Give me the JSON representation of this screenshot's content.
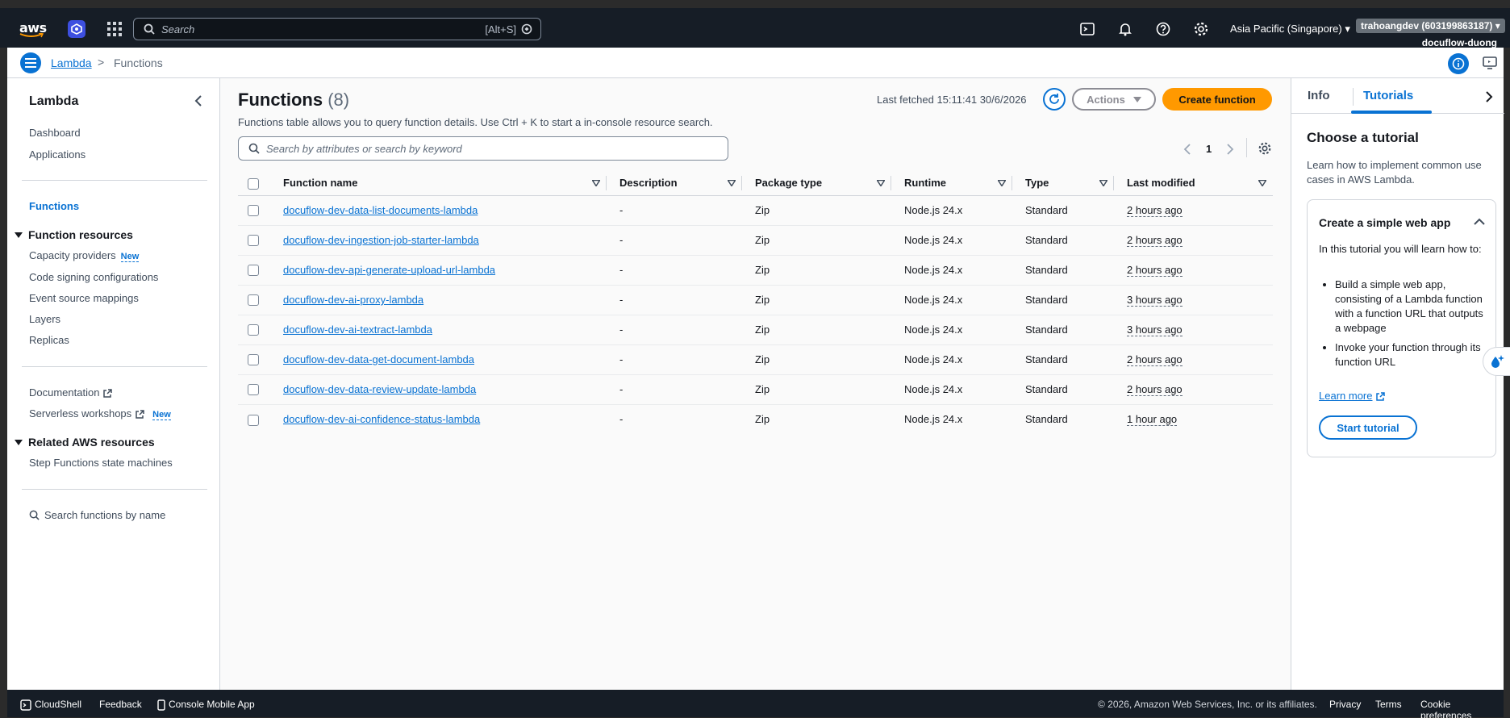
{
  "topnav": {
    "logo_text": "aws",
    "search_placeholder": "Search",
    "search_shortcut": "[Alt+S]",
    "region": "Asia Pacific (Singapore)",
    "account_badge": "trahoangdev (603199863187)",
    "account_name": "docuflow-duong"
  },
  "breadcrumb": {
    "root": "Lambda",
    "separator": ">",
    "current": "Functions"
  },
  "sidebar": {
    "title": "Lambda",
    "top_items": [
      "Dashboard",
      "Applications"
    ],
    "active_item": "Functions",
    "function_resources": {
      "label": "Function resources",
      "items": [
        "Capacity providers",
        "Code signing configurations",
        "Event source mappings",
        "Layers",
        "Replicas"
      ],
      "new_badge": "New"
    },
    "links": {
      "documentation": "Documentation",
      "serverless_workshops": "Serverless workshops",
      "new_badge": "New"
    },
    "related": {
      "label": "Related AWS resources",
      "items": [
        "Step Functions state machines"
      ]
    },
    "search_label": "Search functions by name"
  },
  "main": {
    "title": "Functions",
    "count": "(8)",
    "description": "Functions table allows you to query function details. Use Ctrl + K to start a in-console resource search.",
    "last_fetched": "Last fetched 15:11:41 30/6/2026",
    "actions_label": "Actions",
    "create_label": "Create function",
    "filter_placeholder": "Search by attributes or search by keyword",
    "page_number": "1",
    "columns": [
      "Function name",
      "Description",
      "Package type",
      "Runtime",
      "Type",
      "Last modified"
    ],
    "rows": [
      {
        "name": "docuflow-dev-data-list-documents-lambda",
        "description": "-",
        "package": "Zip",
        "runtime": "Node.js 24.x",
        "type": "Standard",
        "modified": "2 hours ago"
      },
      {
        "name": "docuflow-dev-ingestion-job-starter-lambda",
        "description": "-",
        "package": "Zip",
        "runtime": "Node.js 24.x",
        "type": "Standard",
        "modified": "2 hours ago"
      },
      {
        "name": "docuflow-dev-api-generate-upload-url-lambda",
        "description": "-",
        "package": "Zip",
        "runtime": "Node.js 24.x",
        "type": "Standard",
        "modified": "2 hours ago"
      },
      {
        "name": "docuflow-dev-ai-proxy-lambda",
        "description": "-",
        "package": "Zip",
        "runtime": "Node.js 24.x",
        "type": "Standard",
        "modified": "3 hours ago"
      },
      {
        "name": "docuflow-dev-ai-textract-lambda",
        "description": "-",
        "package": "Zip",
        "runtime": "Node.js 24.x",
        "type": "Standard",
        "modified": "3 hours ago"
      },
      {
        "name": "docuflow-dev-data-get-document-lambda",
        "description": "-",
        "package": "Zip",
        "runtime": "Node.js 24.x",
        "type": "Standard",
        "modified": "2 hours ago"
      },
      {
        "name": "docuflow-dev-data-review-update-lambda",
        "description": "-",
        "package": "Zip",
        "runtime": "Node.js 24.x",
        "type": "Standard",
        "modified": "2 hours ago"
      },
      {
        "name": "docuflow-dev-ai-confidence-status-lambda",
        "description": "-",
        "package": "Zip",
        "runtime": "Node.js 24.x",
        "type": "Standard",
        "modified": "1 hour ago"
      }
    ]
  },
  "right_panel": {
    "tabs": [
      "Info",
      "Tutorials"
    ],
    "active_tab": "Tutorials",
    "heading": "Choose a tutorial",
    "description": "Learn how to implement common use cases in AWS Lambda.",
    "card": {
      "title": "Create a simple web app",
      "intro": "In this tutorial you will learn how to:",
      "bullets": [
        "Build a simple web app, consisting of a Lambda function with a function URL that outputs a webpage",
        "Invoke your function through its function URL"
      ],
      "learn_more": "Learn more",
      "start_label": "Start tutorial"
    }
  },
  "footer": {
    "cloudshell": "CloudShell",
    "feedback": "Feedback",
    "mobile_app": "Console Mobile App",
    "copyright": "© 2026, Amazon Web Services, Inc. or its affiliates.",
    "privacy": "Privacy",
    "terms": "Terms",
    "cookies": "Cookie preferences"
  },
  "colors": {
    "nav_bg": "#161d26",
    "link_blue": "#0972d3",
    "primary_orange": "#ff9900",
    "main_bg": "#fafafa"
  }
}
